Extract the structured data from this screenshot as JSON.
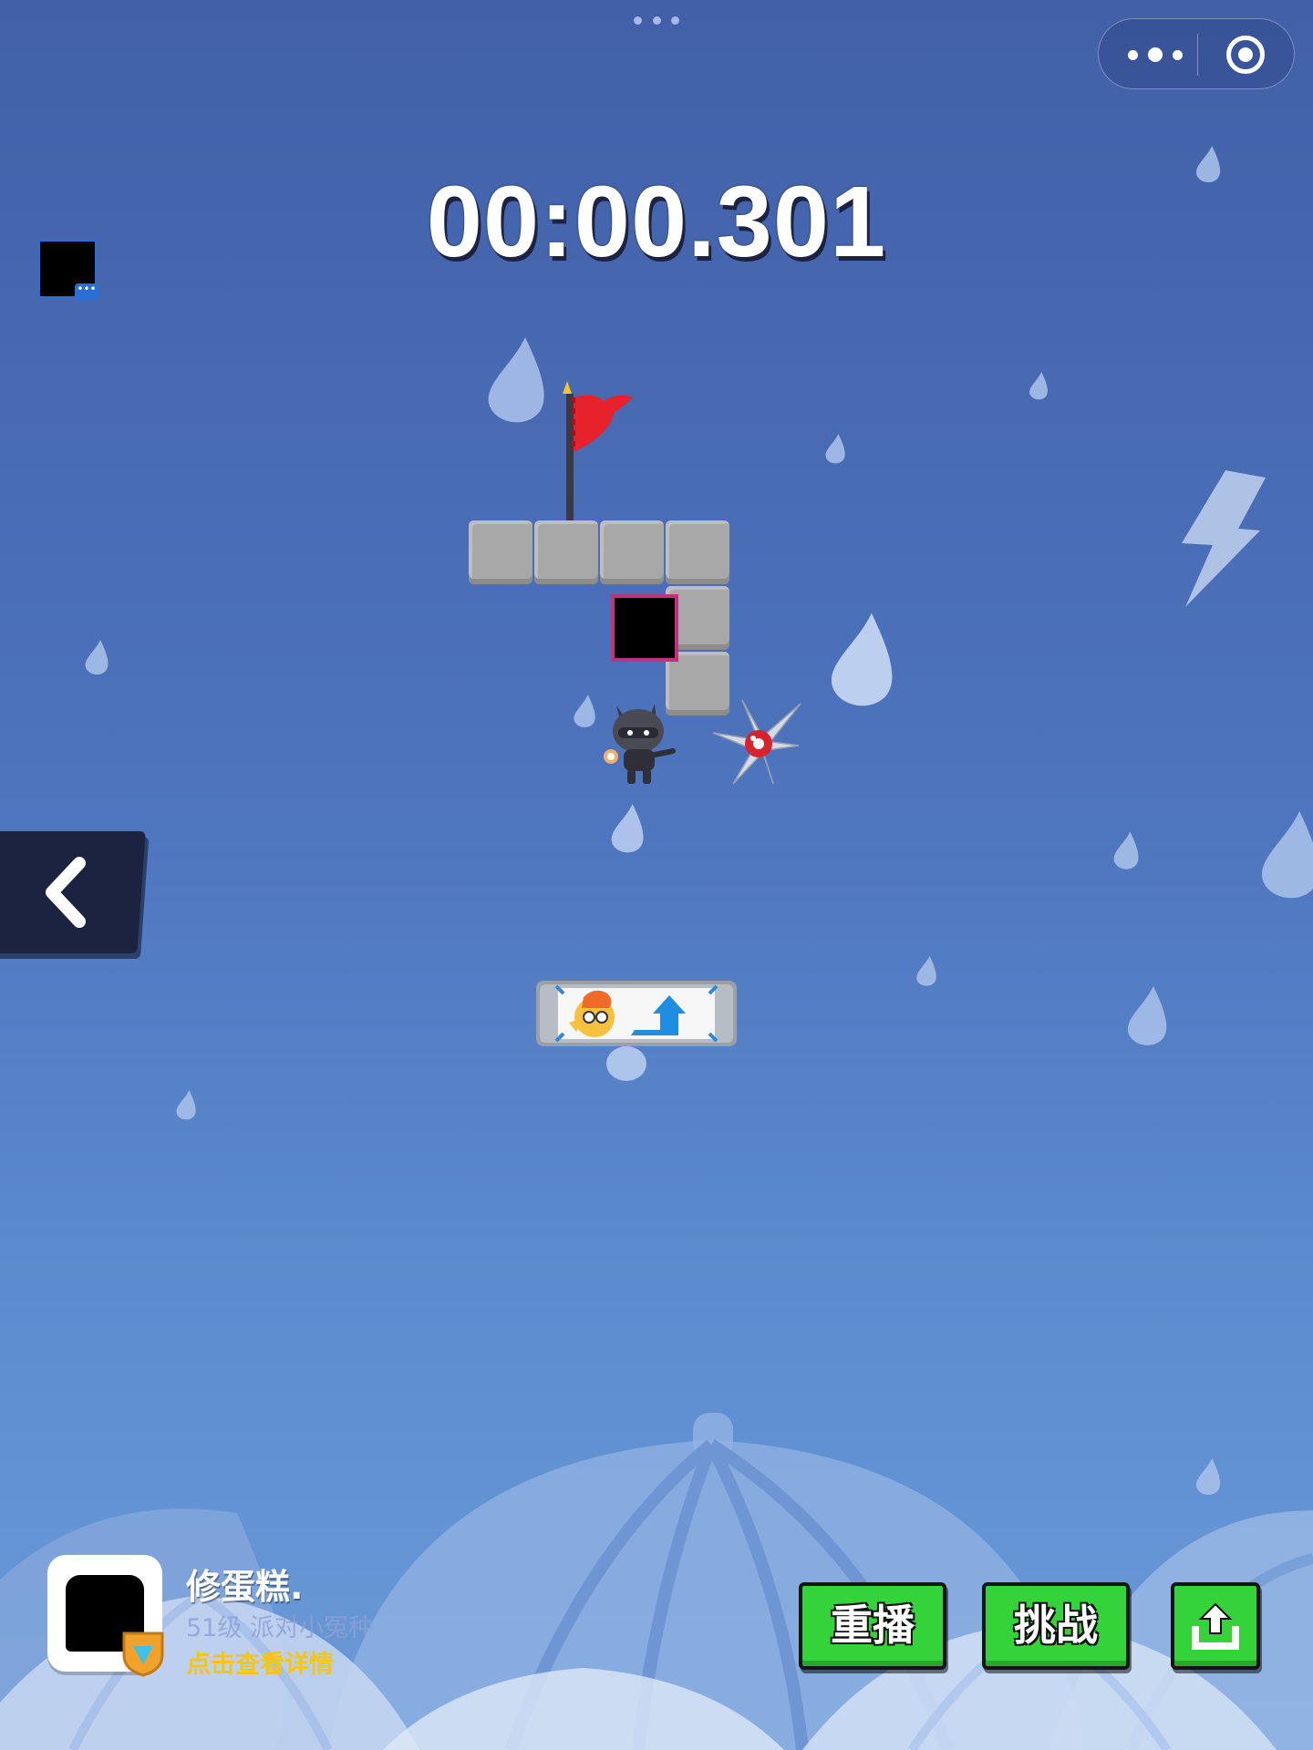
{
  "hud": {
    "timer": "00:00.301",
    "menu_icon": "more-dots-icon",
    "close_icon": "target-close-icon"
  },
  "player": {
    "name": "修蛋糕.",
    "level_title": "51级 派对小冤种",
    "details_link": "点击查看详情"
  },
  "buttons": {
    "replay": "重播",
    "challenge": "挑战",
    "share_icon": "share-upload-icon"
  },
  "level": {
    "goal_icon": "red-flag-icon",
    "hazard_icon": "spiked-ball-icon",
    "hint_icon": "chicken-arrow-sign-icon",
    "back_icon": "chevron-left-icon"
  },
  "colors": {
    "button_green": "#35d33a",
    "flag_red": "#e8222a",
    "level_gold": "#f5c518",
    "target_border": "#c2317e"
  }
}
